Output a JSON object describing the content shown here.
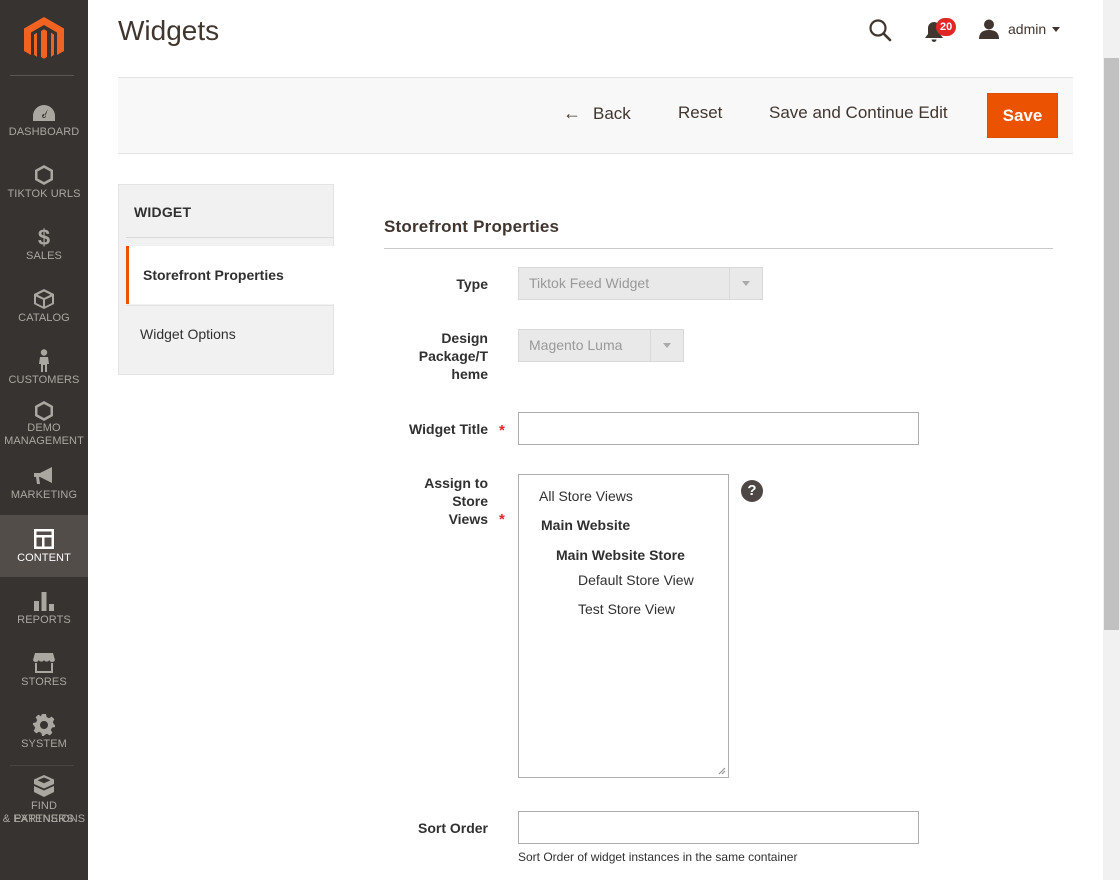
{
  "sidebar": {
    "items": [
      {
        "label": "DASHBOARD",
        "icon": "dashboard-icon"
      },
      {
        "label": "TIKTOK URLS",
        "icon": "hexagon-icon"
      },
      {
        "label": "SALES",
        "icon": "dollar-icon"
      },
      {
        "label": "CATALOG",
        "icon": "cube-icon"
      },
      {
        "label": "CUSTOMERS",
        "icon": "person-icon"
      },
      {
        "label": "DEMO",
        "label2": "MANAGEMENT",
        "icon": "hexagon-icon"
      },
      {
        "label": "MARKETING",
        "icon": "megaphone-icon"
      },
      {
        "label": "CONTENT",
        "icon": "layout-icon",
        "active": true
      },
      {
        "label": "REPORTS",
        "icon": "bar-chart-icon"
      },
      {
        "label": "STORES",
        "icon": "storefront-icon"
      },
      {
        "label": "SYSTEM",
        "icon": "gear-icon"
      },
      {
        "label": "FIND PARTNERS",
        "label2": "& EXTENSIONS",
        "icon": "boxes-icon"
      }
    ]
  },
  "header": {
    "title": "Widgets",
    "notifications_count": "20",
    "user_name": "admin"
  },
  "actions": {
    "back": "Back",
    "reset": "Reset",
    "save_continue": "Save and Continue Edit",
    "save": "Save"
  },
  "tabs": {
    "title": "WIDGET",
    "items": [
      "Storefront Properties",
      "Widget Options"
    ]
  },
  "form": {
    "section_title": "Storefront Properties",
    "type_label": "Type",
    "type_value": "Tiktok Feed Widget",
    "design_label_1": "Design",
    "design_label_2": "Package/T",
    "design_label_3": "heme",
    "design_value": "Magento Luma",
    "title_label": "Widget Title",
    "title_value": "",
    "stores_label_1": "Assign to",
    "stores_label_2": "Store",
    "stores_label_3": "Views",
    "stores_options": [
      "All Store Views",
      "Main Website",
      "Main Website Store",
      "Default Store View",
      "Test Store View"
    ],
    "help": "?",
    "sort_label": "Sort Order",
    "sort_value": "",
    "sort_note": "Sort Order of widget instances in the same container"
  },
  "colors": {
    "accent": "#eb5202",
    "sidebar_bg": "#373330",
    "badge": "#e22626"
  }
}
